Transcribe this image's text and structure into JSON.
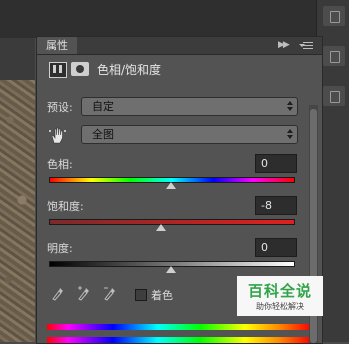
{
  "panel": {
    "tab_label": "属性",
    "title": "色相/饱和度"
  },
  "preset": {
    "label": "预设:",
    "value": "自定"
  },
  "channel": {
    "value": "全图"
  },
  "hue": {
    "label": "色相:",
    "value": "0",
    "slider_fraction": 0.5
  },
  "saturation": {
    "label": "饱和度:",
    "value": "-8",
    "slider_fraction": 0.46
  },
  "lightness": {
    "label": "明度:",
    "value": "0",
    "slider_fraction": 0.5
  },
  "colorize": {
    "label": "着色",
    "checked": false
  },
  "watermark": {
    "title": "百科全说",
    "subtitle": "助你轻松解决"
  },
  "colors": {
    "panel_bg": "#535353",
    "field_bg": "#2d2d2d",
    "watermark_green": "#33a44a"
  },
  "icons": [
    "adjustment-layer-icon",
    "layer-mask-icon",
    "targeted-adjustment-hand-icon",
    "eyedropper-icon",
    "eyedropper-plus-icon",
    "eyedropper-minus-icon",
    "panel-collapse-icon",
    "panel-menu-icon"
  ]
}
